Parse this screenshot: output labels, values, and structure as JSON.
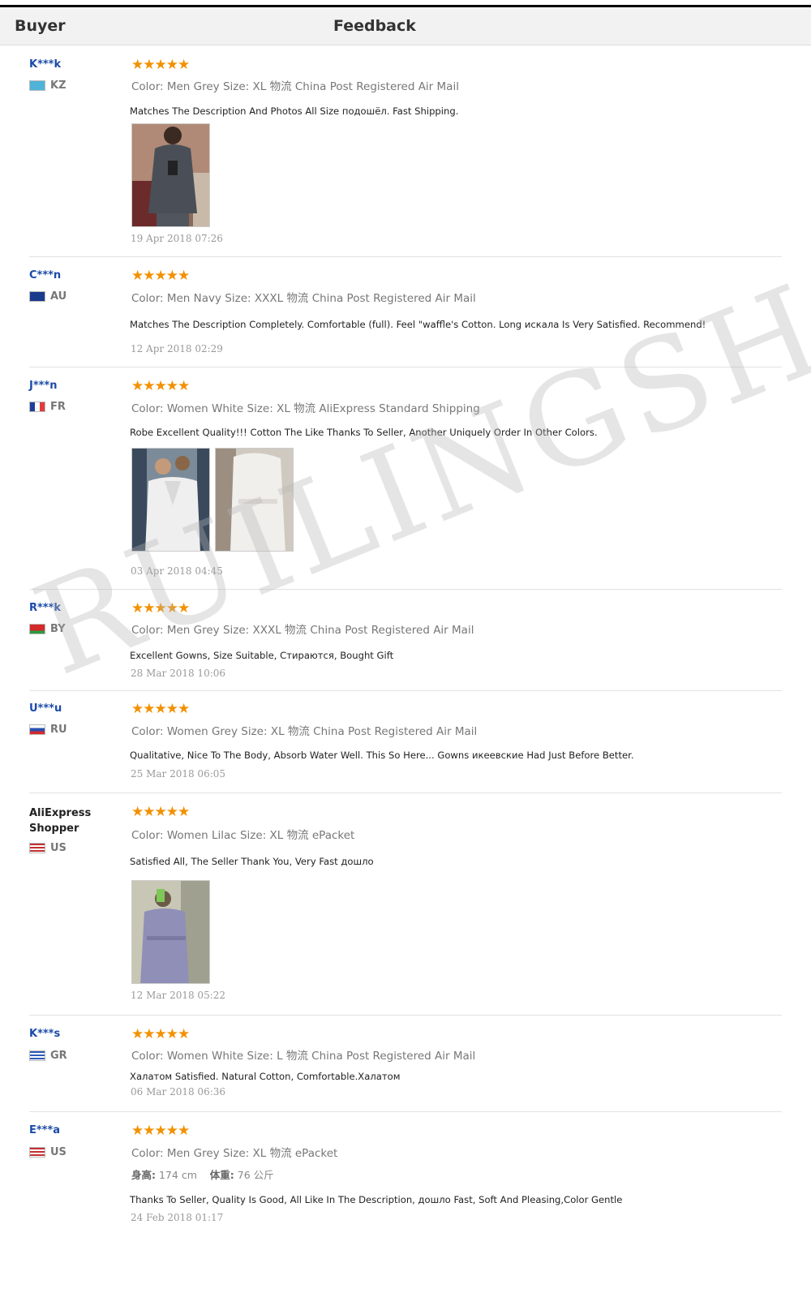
{
  "header": {
    "buyer_label": "Buyer",
    "feedback_label": "Feedback"
  },
  "watermark": "RUILINGSHA",
  "reviews": [
    {
      "buyer": "K***k",
      "country": "KZ",
      "stars": "★★★★★",
      "attrs": "Color: Men Grey  Size: XL  物流  China Post Registered Air Mail",
      "text": "Matches The Description And Photos All Size подошёл. Fast Shipping.",
      "date": "19 Apr 2018 07:26"
    },
    {
      "buyer": "C***n",
      "country": "AU",
      "stars": "★★★★★",
      "attrs": "Color: Men Navy  Size: XXXL  物流  China Post Registered Air Mail",
      "text": "Matches The Description Completely. Comfortable (full). Feel \"waffle's Cotton. Long искала Is Very Satisfied. Recommend!",
      "date": "12 Apr  2018 02:29"
    },
    {
      "buyer": "J***n",
      "country": "FR",
      "stars": "★★★★★",
      "attrs": "Color: Women White  Size: XL  物流  AliExpress Standard Shipping",
      "text": "Robe Excellent Quality!!! Cotton The Like Thanks To Seller, Another Uniquely Order In Other Colors.",
      "date": "03 Apr 2018 04:45"
    },
    {
      "buyer": "R***k",
      "country": "BY",
      "stars": "★★★★★",
      "attrs": "Color: Men Grey  Size: XXXL  物流  China Post Registered Air Mail",
      "text": "Excellent Gowns, Size Suitable, Стираются, Bought Gift",
      "date": "28 Mar 2018 10:06"
    },
    {
      "buyer": "U***u",
      "country": "RU",
      "stars": "★★★★★",
      "attrs": "Color: Women Grey  Size: XL  物流  China Post Registered Air Mail",
      "text": "Qualitative, Nice To The Body, Absorb Water Well. This So Here... Gowns икеевские Had Just Before Better.",
      "date": "25 Mar 2018 06:05"
    },
    {
      "buyer": "AliExpress Shopper",
      "country": "US",
      "stars": "★★★★★",
      "attrs": "Color: Women Lilac   Size: XL  物流   ePacket",
      "text": "Satisfied All, The Seller Thank You, Very Fast дошло",
      "date": "12 Mar 2018 05:22"
    },
    {
      "buyer": "K***s",
      "country": "GR",
      "stars": "★★★★★",
      "attrs": "Color: Women White   Size: L  物流  China Post Registered Air Mail",
      "text": "Халатом Satisfied. Natural Cotton, Comfortable.Халатом",
      "date": "06 Mar 2018 06:36"
    },
    {
      "buyer": "E***a",
      "country": "US",
      "stars": "★★★★★",
      "attrs": "Color: Men Grey   Size: XL  物流   ePacket",
      "height_label": "身高:",
      "height_value": "174 cm",
      "weight_label": "体重:",
      "weight_value": "76 公斤",
      "text": "Thanks To Seller, Quality Is Good, All Like In The Description, дошло Fast, Soft And Pleasing,Color Gentle",
      "date": "24 Feb 2018 01:17"
    }
  ]
}
